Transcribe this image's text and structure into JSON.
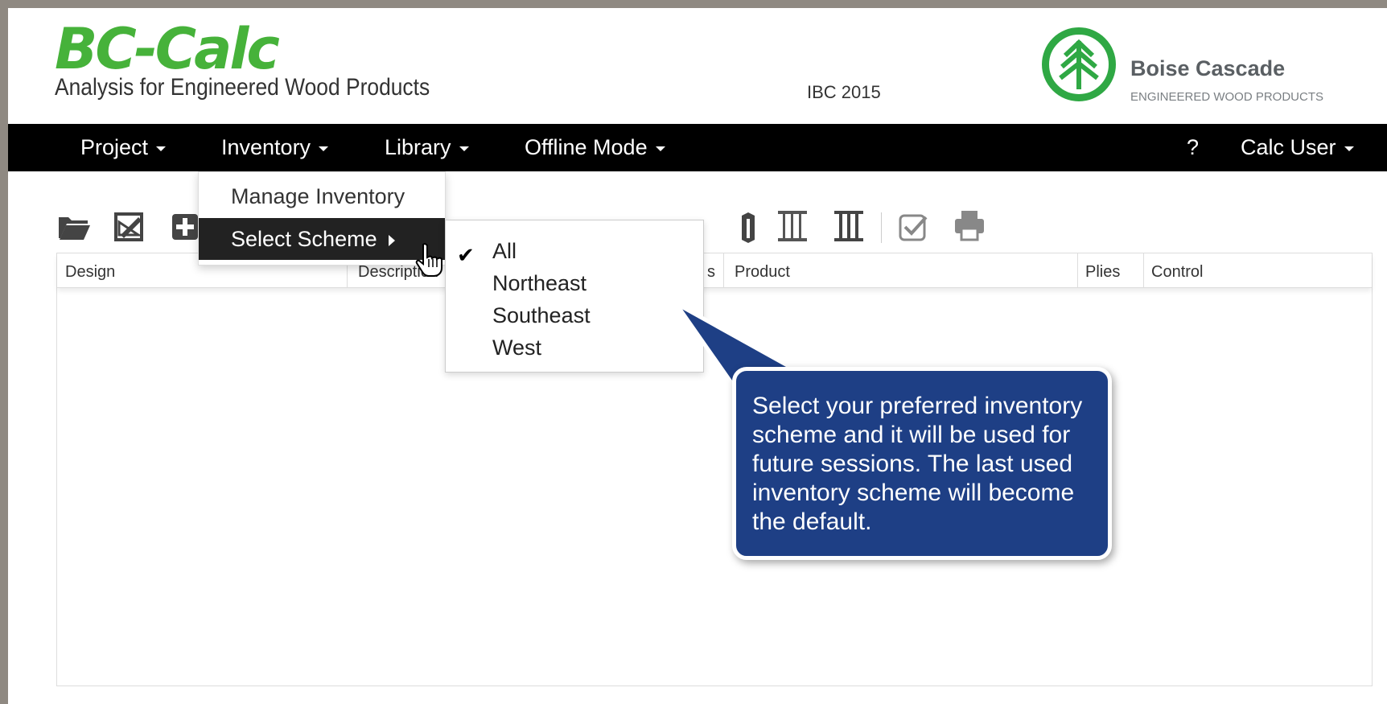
{
  "header": {
    "logo_text": "BC-Calc",
    "subtitle": "Analysis for Engineered Wood Products",
    "code_version": "IBC 2015",
    "brand_name": "Boise Cascade",
    "brand_tagline": "ENGINEERED WOOD PRODUCTS"
  },
  "nav": {
    "project": "Project",
    "inventory": "Inventory",
    "library": "Library",
    "offline_mode": "Offline Mode",
    "help": "?",
    "user": "Calc User"
  },
  "toolbar": {
    "icons": [
      "folder-open-icon",
      "edit-drawing-icon",
      "add-icon",
      "beam-icon",
      "column-icon",
      "post-icon",
      "column-stack-icon",
      "column-double-icon",
      "check-icon",
      "print-icon"
    ]
  },
  "inventory_menu": {
    "manage": "Manage Inventory",
    "select_scheme": "Select Scheme"
  },
  "scheme_menu": {
    "options": [
      "All",
      "Northeast",
      "Southeast",
      "West"
    ],
    "selected": "All"
  },
  "table": {
    "columns": [
      "Design",
      "Description",
      "s",
      "Product",
      "Plies",
      "Control"
    ]
  },
  "callout": {
    "text": "Select your preferred inventory scheme and it will be used for future sessions. The last used inventory scheme will become the default."
  },
  "colors": {
    "logo_green": "#46b23a",
    "brand_green": "#2fa844",
    "navbar": "#000000",
    "callout_bg": "#1e3f85"
  }
}
